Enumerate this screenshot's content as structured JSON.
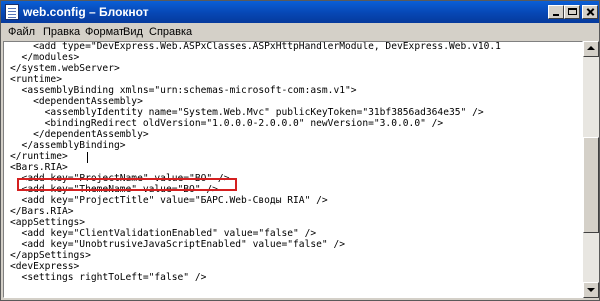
{
  "window": {
    "title": "web.config – Блокнот"
  },
  "menu": {
    "items": [
      "Файл",
      "Правка",
      "Формат",
      "Вид",
      "Справка"
    ]
  },
  "editor": {
    "lines": [
      "    <add type=\"DevExpress.Web.ASPxClasses.ASPxHttpHandlerModule, DevExpress.Web.v10.1",
      "  </modules>",
      "</system.webServer>",
      "<runtime>",
      "  <assemblyBinding xmlns=\"urn:schemas-microsoft-com:asm.v1\">",
      "    <dependentAssembly>",
      "      <assemblyIdentity name=\"System.Web.Mvc\" publicKeyToken=\"31bf3856ad364e35\" />",
      "      <bindingRedirect oldVersion=\"1.0.0.0-2.0.0.0\" newVersion=\"3.0.0.0\" />",
      "    </dependentAssembly>",
      "  </assemblyBinding>",
      "</runtime>",
      "<Bars.RIA>",
      "  <add key=\"ProjectName\" value=\"BO\" />",
      "  <add key=\"ThemeName\" value=\"BO\" />",
      "  <add key=\"ProjectTitle\" value=\"БАРС.Web-Своды RIA\" />",
      "</Bars.RIA>",
      "<appSettings>",
      "  <add key=\"ClientValidationEnabled\" value=\"false\" />",
      "  <add key=\"UnobtrusiveJavaScriptEnabled\" value=\"false\" />",
      "</appSettings>",
      "<devExpress>",
      "  <settings rightToLeft=\"false\" />"
    ],
    "highlight_color": "#d42020"
  },
  "colors": {
    "titlebar": "#0747b4",
    "chrome": "#d4d0c8",
    "editor_bg": "#ffffff"
  },
  "icons": {
    "app": "notepad-icon",
    "minimize": "minimize-icon",
    "maximize": "maximize-icon",
    "close": "close-icon"
  }
}
